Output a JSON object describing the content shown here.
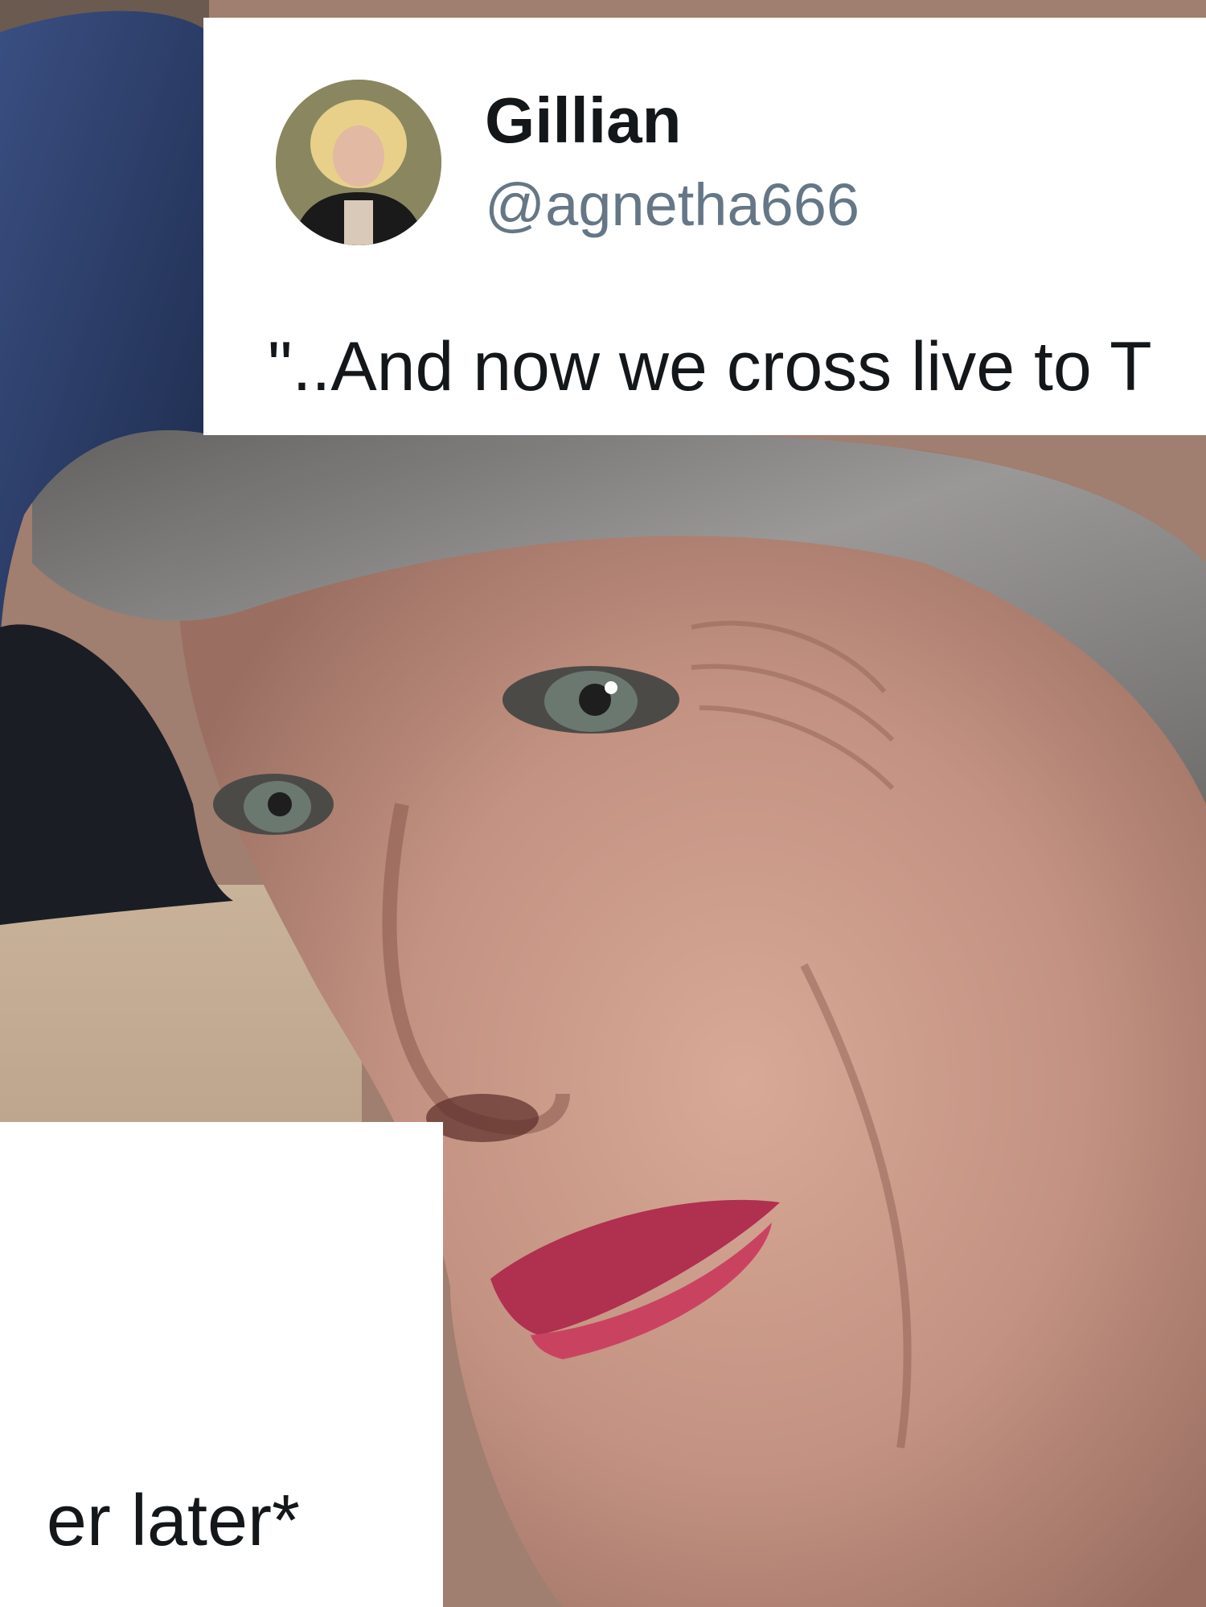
{
  "tweet": {
    "display_name": "Gillian",
    "handle": "@agnetha666",
    "text_visible": "\"..And now we cross live to T",
    "text_bottom_visible": "er later*"
  },
  "avatar": {
    "icon": "profile-photo"
  },
  "background": {
    "description_icon": "portrait-photo"
  },
  "colors": {
    "card": "#ffffff",
    "name": "#14171a",
    "handle": "#657786",
    "hat_navy": "#2e3f66",
    "lip": "#b0304f"
  }
}
